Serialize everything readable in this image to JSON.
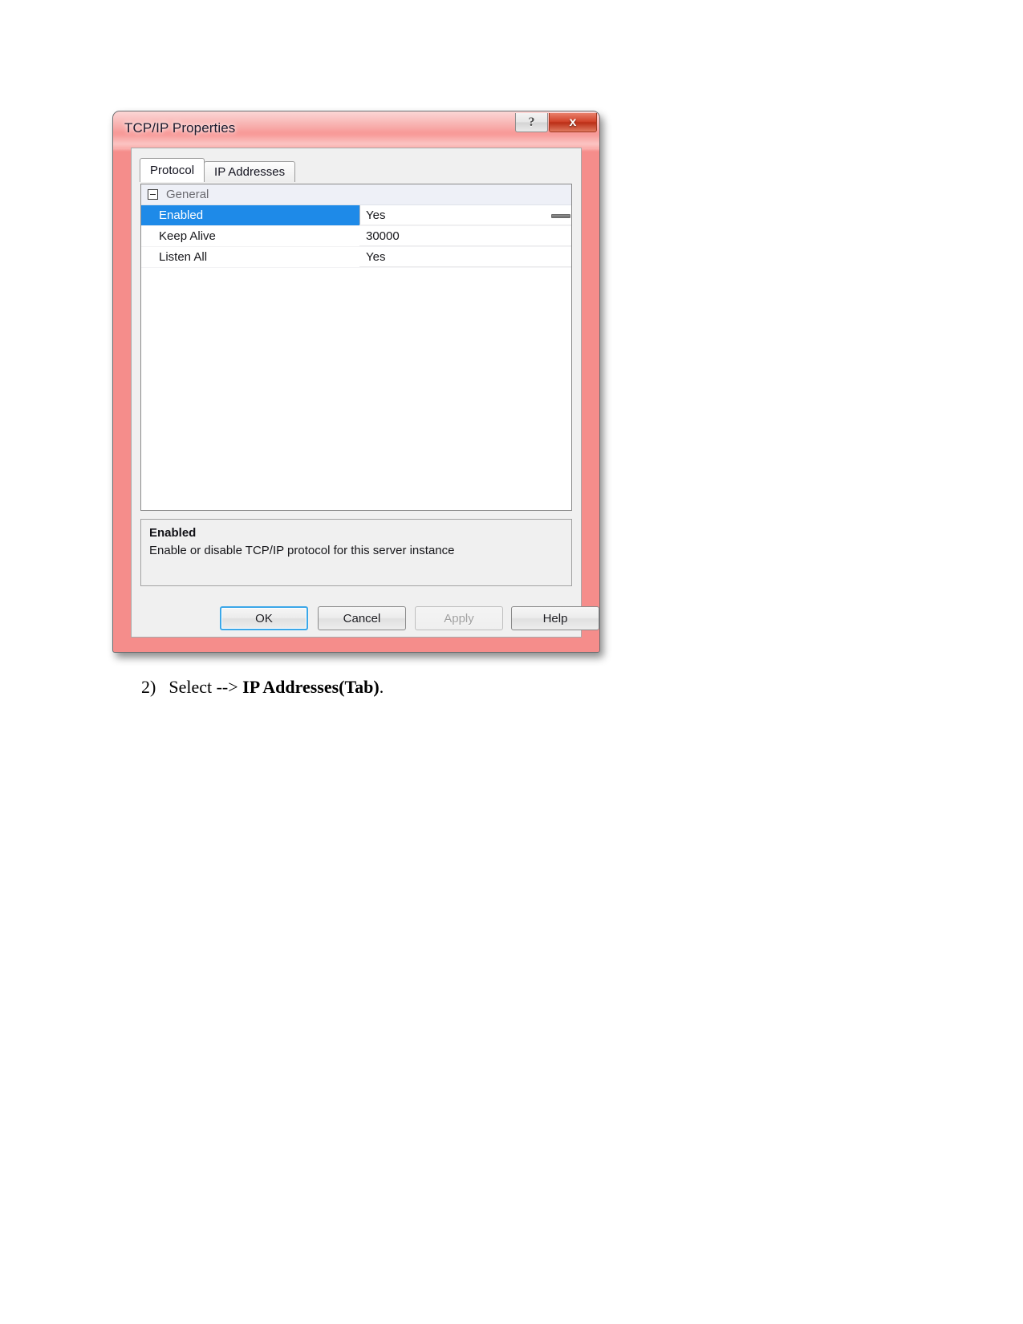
{
  "window": {
    "title": "TCP/IP Properties",
    "caption_buttons": [
      {
        "name": "help",
        "glyph": "?"
      },
      {
        "name": "close",
        "glyph": "x"
      }
    ],
    "frame_color": "#f58d8b",
    "close_color": "#d2452c"
  },
  "tabs": [
    {
      "label": "Protocol",
      "active": true
    },
    {
      "label": "IP Addresses",
      "active": false
    }
  ],
  "grid": {
    "group_label": "General",
    "rows": [
      {
        "name": "Enabled",
        "value": "Yes",
        "selected": true
      },
      {
        "name": "Keep Alive",
        "value": "30000",
        "selected": false
      },
      {
        "name": "Listen All",
        "value": "Yes",
        "selected": false
      }
    ],
    "selection_color": "#1e8ae8"
  },
  "description": {
    "title": "Enabled",
    "text": "Enable or disable TCP/IP protocol for this server instance"
  },
  "buttons": {
    "ok": "OK",
    "cancel": "Cancel",
    "apply": "Apply",
    "help": "Help"
  },
  "caption": {
    "number": "2)",
    "prefix": "Select --> ",
    "bold": "IP Addresses(Tab)",
    "suffix": "."
  }
}
